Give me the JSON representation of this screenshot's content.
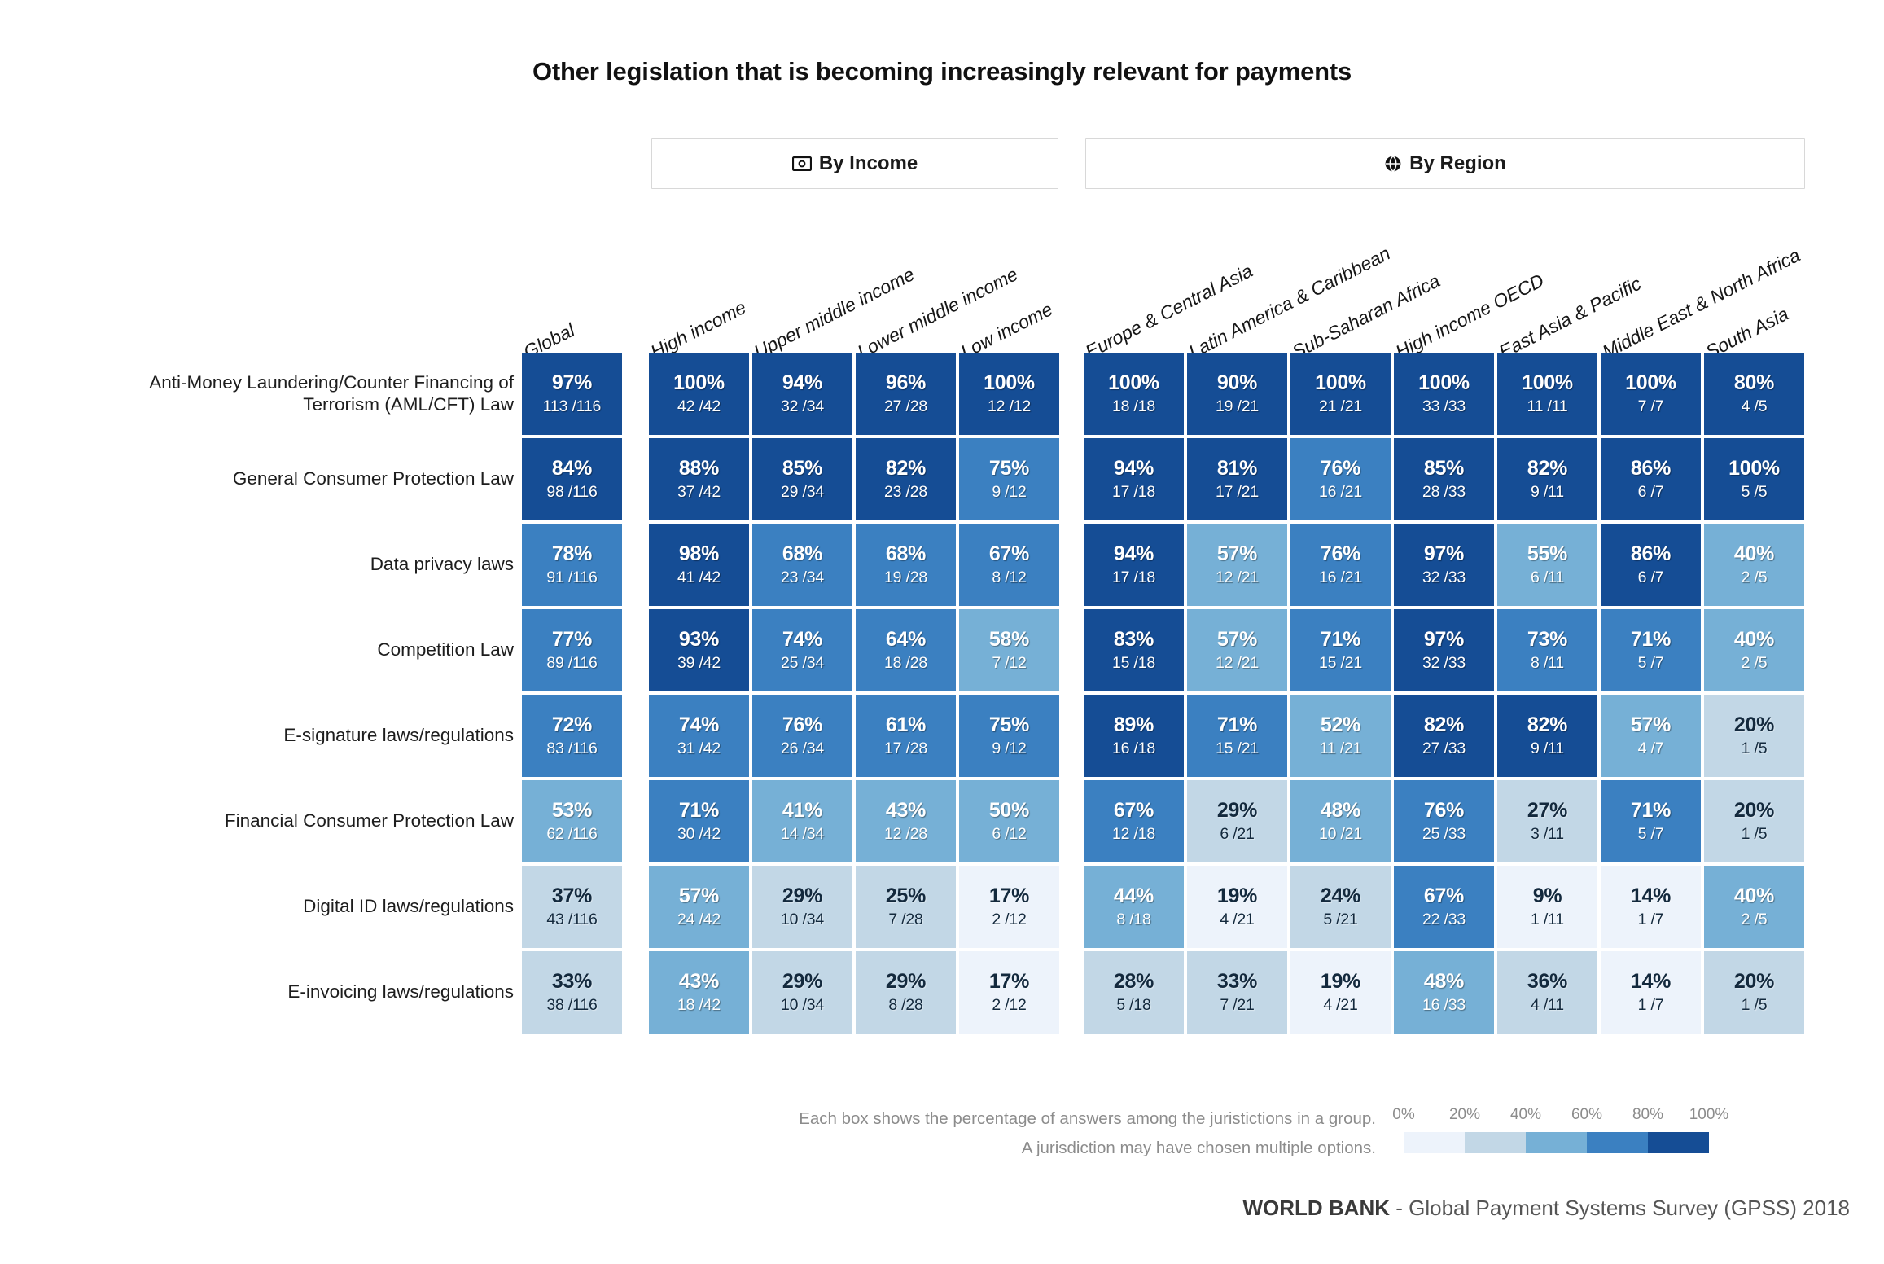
{
  "title": "Other legislation that is becoming increasingly relevant for payments",
  "groups": [
    {
      "id": "income",
      "label": "By Income",
      "icon": "banknote-icon"
    },
    {
      "id": "region",
      "label": "By Region",
      "icon": "globe-icon"
    }
  ],
  "columns": [
    {
      "label": "Global",
      "group": "global"
    },
    {
      "label": "High income",
      "group": "income"
    },
    {
      "label": "Upper middle income",
      "group": "income"
    },
    {
      "label": "Lower middle income",
      "group": "income"
    },
    {
      "label": "Low income",
      "group": "income"
    },
    {
      "label": "Europe & Central Asia",
      "group": "region"
    },
    {
      "label": "Latin America & Caribbean",
      "group": "region"
    },
    {
      "label": "Sub-Saharan Africa",
      "group": "region"
    },
    {
      "label": "High income OECD",
      "group": "region"
    },
    {
      "label": "East Asia & Pacific",
      "group": "region"
    },
    {
      "label": "Middle East & North Africa",
      "group": "region"
    },
    {
      "label": "South Asia",
      "group": "region"
    }
  ],
  "rows": [
    "Anti-Money Laundering/Counter Financing of Terrorism (AML/CFT) Law",
    "General Consumer Protection Law",
    "Data privacy laws",
    "Competition Law",
    "E-signature laws/regulations",
    "Financial Consumer Protection Law",
    "Digital ID laws/regulations",
    "E-invoicing laws/regulations"
  ],
  "footer": {
    "note_line1": "Each box shows the percentage of answers among the juristictions in a group.",
    "note_line2": "A jurisdiction may have chosen multiple options.",
    "attribution_bold": "WORLD BANK",
    "attribution_rest": " - Global Payment Systems Survey (GPSS) 2018"
  },
  "legend": {
    "ticks": [
      "0%",
      "20%",
      "40%",
      "60%",
      "80%",
      "100%"
    ],
    "colors": [
      "#edf3fb",
      "#c2d7e6",
      "#76b0d6",
      "#3b80c1",
      "#154d95"
    ]
  },
  "chart_data": {
    "type": "heatmap",
    "title": "Other legislation that is becoming increasingly relevant for payments",
    "xlabel": "",
    "ylabel": "",
    "value_unit": "percent",
    "legend_position": "bottom-right",
    "colorscale_bins": [
      0,
      20,
      40,
      60,
      80,
      100
    ],
    "x_categories": [
      "Global",
      "High income",
      "Upper middle income",
      "Lower middle income",
      "Low income",
      "Europe & Central Asia",
      "Latin America & Caribbean",
      "Sub-Saharan Africa",
      "High income OECD",
      "East Asia & Pacific",
      "Middle East & North Africa",
      "South Asia"
    ],
    "y_categories": [
      "Anti-Money Laundering/Counter Financing of Terrorism (AML/CFT) Law",
      "General Consumer Protection Law",
      "Data privacy laws",
      "Competition Law",
      "E-signature laws/regulations",
      "Financial Consumer Protection Law",
      "Digital ID laws/regulations",
      "E-invoicing laws/regulations"
    ],
    "cells": [
      [
        {
          "pct": 97,
          "label": "97%",
          "frac": "113 /116",
          "num": 113,
          "den": 116
        },
        {
          "pct": 100,
          "label": "100%",
          "frac": "42 /42",
          "num": 42,
          "den": 42
        },
        {
          "pct": 94,
          "label": "94%",
          "frac": "32 /34",
          "num": 32,
          "den": 34
        },
        {
          "pct": 96,
          "label": "96%",
          "frac": "27 /28",
          "num": 27,
          "den": 28
        },
        {
          "pct": 100,
          "label": "100%",
          "frac": "12 /12",
          "num": 12,
          "den": 12
        },
        {
          "pct": 100,
          "label": "100%",
          "frac": "18 /18",
          "num": 18,
          "den": 18
        },
        {
          "pct": 90,
          "label": "90%",
          "frac": "19 /21",
          "num": 19,
          "den": 21
        },
        {
          "pct": 100,
          "label": "100%",
          "frac": "21 /21",
          "num": 21,
          "den": 21
        },
        {
          "pct": 100,
          "label": "100%",
          "frac": "33 /33",
          "num": 33,
          "den": 33
        },
        {
          "pct": 100,
          "label": "100%",
          "frac": "11 /11",
          "num": 11,
          "den": 11
        },
        {
          "pct": 100,
          "label": "100%",
          "frac": "7 /7",
          "num": 7,
          "den": 7
        },
        {
          "pct": 80,
          "label": "80%",
          "frac": "4 /5",
          "num": 4,
          "den": 5
        }
      ],
      [
        {
          "pct": 84,
          "label": "84%",
          "frac": "98 /116",
          "num": 98,
          "den": 116
        },
        {
          "pct": 88,
          "label": "88%",
          "frac": "37 /42",
          "num": 37,
          "den": 42
        },
        {
          "pct": 85,
          "label": "85%",
          "frac": "29 /34",
          "num": 29,
          "den": 34
        },
        {
          "pct": 82,
          "label": "82%",
          "frac": "23 /28",
          "num": 23,
          "den": 28
        },
        {
          "pct": 75,
          "label": "75%",
          "frac": "9 /12",
          "num": 9,
          "den": 12
        },
        {
          "pct": 94,
          "label": "94%",
          "frac": "17 /18",
          "num": 17,
          "den": 18
        },
        {
          "pct": 81,
          "label": "81%",
          "frac": "17 /21",
          "num": 17,
          "den": 21
        },
        {
          "pct": 76,
          "label": "76%",
          "frac": "16 /21",
          "num": 16,
          "den": 21
        },
        {
          "pct": 85,
          "label": "85%",
          "frac": "28 /33",
          "num": 28,
          "den": 33
        },
        {
          "pct": 82,
          "label": "82%",
          "frac": "9 /11",
          "num": 9,
          "den": 11
        },
        {
          "pct": 86,
          "label": "86%",
          "frac": "6 /7",
          "num": 6,
          "den": 7
        },
        {
          "pct": 100,
          "label": "100%",
          "frac": "5 /5",
          "num": 5,
          "den": 5
        }
      ],
      [
        {
          "pct": 78,
          "label": "78%",
          "frac": "91 /116",
          "num": 91,
          "den": 116
        },
        {
          "pct": 98,
          "label": "98%",
          "frac": "41 /42",
          "num": 41,
          "den": 42
        },
        {
          "pct": 68,
          "label": "68%",
          "frac": "23 /34",
          "num": 23,
          "den": 34
        },
        {
          "pct": 68,
          "label": "68%",
          "frac": "19 /28",
          "num": 19,
          "den": 28
        },
        {
          "pct": 67,
          "label": "67%",
          "frac": "8 /12",
          "num": 8,
          "den": 12
        },
        {
          "pct": 94,
          "label": "94%",
          "frac": "17 /18",
          "num": 17,
          "den": 18
        },
        {
          "pct": 57,
          "label": "57%",
          "frac": "12 /21",
          "num": 12,
          "den": 21
        },
        {
          "pct": 76,
          "label": "76%",
          "frac": "16 /21",
          "num": 16,
          "den": 21
        },
        {
          "pct": 97,
          "label": "97%",
          "frac": "32 /33",
          "num": 32,
          "den": 33
        },
        {
          "pct": 55,
          "label": "55%",
          "frac": "6 /11",
          "num": 6,
          "den": 11
        },
        {
          "pct": 86,
          "label": "86%",
          "frac": "6 /7",
          "num": 6,
          "den": 7
        },
        {
          "pct": 40,
          "label": "40%",
          "frac": "2 /5",
          "num": 2,
          "den": 5
        }
      ],
      [
        {
          "pct": 77,
          "label": "77%",
          "frac": "89 /116",
          "num": 89,
          "den": 116
        },
        {
          "pct": 93,
          "label": "93%",
          "frac": "39 /42",
          "num": 39,
          "den": 42
        },
        {
          "pct": 74,
          "label": "74%",
          "frac": "25 /34",
          "num": 25,
          "den": 34
        },
        {
          "pct": 64,
          "label": "64%",
          "frac": "18 /28",
          "num": 18,
          "den": 28
        },
        {
          "pct": 58,
          "label": "58%",
          "frac": "7 /12",
          "num": 7,
          "den": 12
        },
        {
          "pct": 83,
          "label": "83%",
          "frac": "15 /18",
          "num": 15,
          "den": 18
        },
        {
          "pct": 57,
          "label": "57%",
          "frac": "12 /21",
          "num": 12,
          "den": 21
        },
        {
          "pct": 71,
          "label": "71%",
          "frac": "15 /21",
          "num": 15,
          "den": 21
        },
        {
          "pct": 97,
          "label": "97%",
          "frac": "32 /33",
          "num": 32,
          "den": 33
        },
        {
          "pct": 73,
          "label": "73%",
          "frac": "8 /11",
          "num": 8,
          "den": 11
        },
        {
          "pct": 71,
          "label": "71%",
          "frac": "5 /7",
          "num": 5,
          "den": 7
        },
        {
          "pct": 40,
          "label": "40%",
          "frac": "2 /5",
          "num": 2,
          "den": 5
        }
      ],
      [
        {
          "pct": 72,
          "label": "72%",
          "frac": "83 /116",
          "num": 83,
          "den": 116
        },
        {
          "pct": 74,
          "label": "74%",
          "frac": "31 /42",
          "num": 31,
          "den": 42
        },
        {
          "pct": 76,
          "label": "76%",
          "frac": "26 /34",
          "num": 26,
          "den": 34
        },
        {
          "pct": 61,
          "label": "61%",
          "frac": "17 /28",
          "num": 17,
          "den": 28
        },
        {
          "pct": 75,
          "label": "75%",
          "frac": "9 /12",
          "num": 9,
          "den": 12
        },
        {
          "pct": 89,
          "label": "89%",
          "frac": "16 /18",
          "num": 16,
          "den": 18
        },
        {
          "pct": 71,
          "label": "71%",
          "frac": "15 /21",
          "num": 15,
          "den": 21
        },
        {
          "pct": 52,
          "label": "52%",
          "frac": "11 /21",
          "num": 11,
          "den": 21
        },
        {
          "pct": 82,
          "label": "82%",
          "frac": "27 /33",
          "num": 27,
          "den": 33
        },
        {
          "pct": 82,
          "label": "82%",
          "frac": "9 /11",
          "num": 9,
          "den": 11
        },
        {
          "pct": 57,
          "label": "57%",
          "frac": "4 /7",
          "num": 4,
          "den": 7
        },
        {
          "pct": 20,
          "label": "20%",
          "frac": "1 /5",
          "num": 1,
          "den": 5
        }
      ],
      [
        {
          "pct": 53,
          "label": "53%",
          "frac": "62 /116",
          "num": 62,
          "den": 116
        },
        {
          "pct": 71,
          "label": "71%",
          "frac": "30 /42",
          "num": 30,
          "den": 42
        },
        {
          "pct": 41,
          "label": "41%",
          "frac": "14 /34",
          "num": 14,
          "den": 34
        },
        {
          "pct": 43,
          "label": "43%",
          "frac": "12 /28",
          "num": 12,
          "den": 28
        },
        {
          "pct": 50,
          "label": "50%",
          "frac": "6 /12",
          "num": 6,
          "den": 12
        },
        {
          "pct": 67,
          "label": "67%",
          "frac": "12 /18",
          "num": 12,
          "den": 18
        },
        {
          "pct": 29,
          "label": "29%",
          "frac": "6 /21",
          "num": 6,
          "den": 21
        },
        {
          "pct": 48,
          "label": "48%",
          "frac": "10 /21",
          "num": 10,
          "den": 21
        },
        {
          "pct": 76,
          "label": "76%",
          "frac": "25 /33",
          "num": 25,
          "den": 33
        },
        {
          "pct": 27,
          "label": "27%",
          "frac": "3 /11",
          "num": 3,
          "den": 11
        },
        {
          "pct": 71,
          "label": "71%",
          "frac": "5 /7",
          "num": 5,
          "den": 7
        },
        {
          "pct": 20,
          "label": "20%",
          "frac": "1 /5",
          "num": 1,
          "den": 5
        }
      ],
      [
        {
          "pct": 37,
          "label": "37%",
          "frac": "43 /116",
          "num": 43,
          "den": 116
        },
        {
          "pct": 57,
          "label": "57%",
          "frac": "24 /42",
          "num": 24,
          "den": 42
        },
        {
          "pct": 29,
          "label": "29%",
          "frac": "10 /34",
          "num": 10,
          "den": 34
        },
        {
          "pct": 25,
          "label": "25%",
          "frac": "7 /28",
          "num": 7,
          "den": 28
        },
        {
          "pct": 17,
          "label": "17%",
          "frac": "2 /12",
          "num": 2,
          "den": 12
        },
        {
          "pct": 44,
          "label": "44%",
          "frac": "8 /18",
          "num": 8,
          "den": 18
        },
        {
          "pct": 19,
          "label": "19%",
          "frac": "4 /21",
          "num": 4,
          "den": 21
        },
        {
          "pct": 24,
          "label": "24%",
          "frac": "5 /21",
          "num": 5,
          "den": 21
        },
        {
          "pct": 67,
          "label": "67%",
          "frac": "22 /33",
          "num": 22,
          "den": 33
        },
        {
          "pct": 9,
          "label": "9%",
          "frac": "1 /11",
          "num": 1,
          "den": 11
        },
        {
          "pct": 14,
          "label": "14%",
          "frac": "1 /7",
          "num": 1,
          "den": 7
        },
        {
          "pct": 40,
          "label": "40%",
          "frac": "2 /5",
          "num": 2,
          "den": 5
        }
      ],
      [
        {
          "pct": 33,
          "label": "33%",
          "frac": "38 /116",
          "num": 38,
          "den": 116
        },
        {
          "pct": 43,
          "label": "43%",
          "frac": "18 /42",
          "num": 18,
          "den": 42
        },
        {
          "pct": 29,
          "label": "29%",
          "frac": "10 /34",
          "num": 10,
          "den": 34
        },
        {
          "pct": 29,
          "label": "29%",
          "frac": "8 /28",
          "num": 8,
          "den": 28
        },
        {
          "pct": 17,
          "label": "17%",
          "frac": "2 /12",
          "num": 2,
          "den": 12
        },
        {
          "pct": 28,
          "label": "28%",
          "frac": "5 /18",
          "num": 5,
          "den": 18
        },
        {
          "pct": 33,
          "label": "33%",
          "frac": "7 /21",
          "num": 7,
          "den": 21
        },
        {
          "pct": 19,
          "label": "19%",
          "frac": "4 /21",
          "num": 4,
          "den": 21
        },
        {
          "pct": 48,
          "label": "48%",
          "frac": "16 /33",
          "num": 16,
          "den": 33
        },
        {
          "pct": 36,
          "label": "36%",
          "frac": "4 /11",
          "num": 4,
          "den": 11
        },
        {
          "pct": 14,
          "label": "14%",
          "frac": "1 /7",
          "num": 1,
          "den": 7
        },
        {
          "pct": 20,
          "label": "20%",
          "frac": "1 /5",
          "num": 1,
          "den": 5
        }
      ]
    ]
  }
}
